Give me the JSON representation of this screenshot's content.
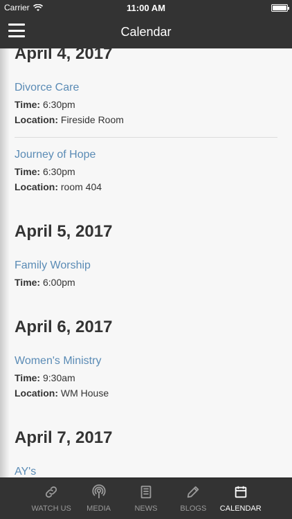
{
  "status_bar": {
    "carrier": "Carrier",
    "time": "11:00 AM"
  },
  "nav": {
    "title": "Calendar"
  },
  "days": [
    {
      "date": "April 4, 2017",
      "events": [
        {
          "title": "Divorce Care",
          "time_label": "Time:",
          "time": "6:30pm",
          "location_label": "Location:",
          "location": "Fireside Room"
        },
        {
          "title": "Journey of Hope",
          "time_label": "Time:",
          "time": "6:30pm",
          "location_label": "Location:",
          "location": "room 404"
        }
      ]
    },
    {
      "date": "April 5, 2017",
      "events": [
        {
          "title": "Family Worship",
          "time_label": "Time:",
          "time": "6:00pm"
        }
      ]
    },
    {
      "date": "April 6, 2017",
      "events": [
        {
          "title": "Women's Ministry",
          "time_label": "Time:",
          "time": "9:30am",
          "location_label": "Location:",
          "location": "WM House"
        }
      ]
    },
    {
      "date": "April 7, 2017",
      "events": [
        {
          "title": "AY's"
        }
      ]
    }
  ],
  "tabs": [
    {
      "label": "WATCH US",
      "icon": "link-icon",
      "active": false
    },
    {
      "label": "MEDIA",
      "icon": "podcast-icon",
      "active": false
    },
    {
      "label": "NEWS",
      "icon": "newspaper-icon",
      "active": false
    },
    {
      "label": "BLOGS",
      "icon": "pencil-icon",
      "active": false
    },
    {
      "label": "CALENDAR",
      "icon": "calendar-icon",
      "active": true
    }
  ]
}
